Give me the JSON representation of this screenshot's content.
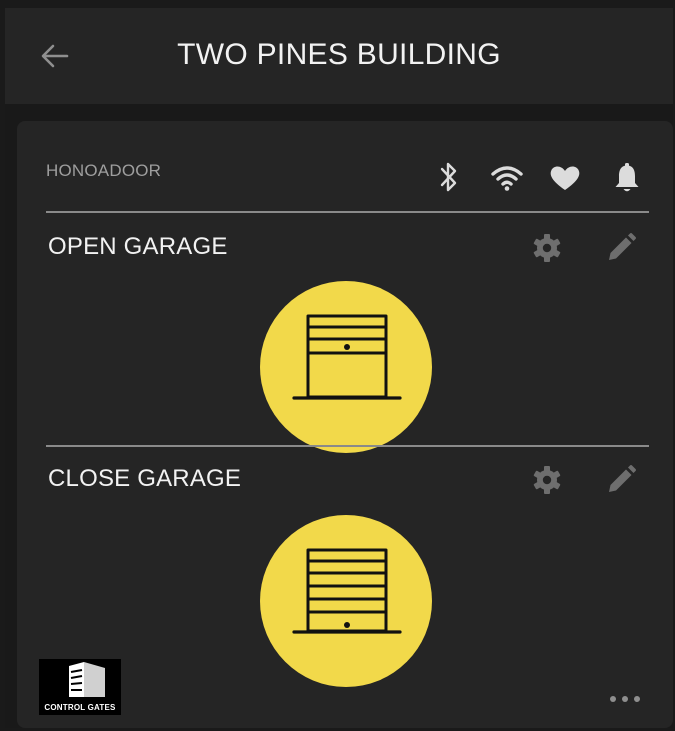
{
  "header": {
    "title": "TWO PINES BUILDING",
    "back_icon": "arrow-left-icon"
  },
  "device": {
    "name": "HONOADOOR",
    "status_icons": [
      "bluetooth-icon",
      "wifi-icon",
      "heart-icon",
      "bell-icon"
    ]
  },
  "actions": [
    {
      "label": "OPEN GARAGE",
      "icons": [
        "gear-icon",
        "pencil-icon"
      ],
      "button_icon": "garage-door-open-icon"
    },
    {
      "label": "CLOSE GARAGE",
      "icons": [
        "gear-icon",
        "pencil-icon"
      ],
      "button_icon": "garage-door-closed-icon"
    }
  ],
  "footer": {
    "logo_text": "CONTROL GATES",
    "more_icon": "more-horizontal-icon"
  },
  "colors": {
    "background": "#191919",
    "header": "#252525",
    "panel": "#252525",
    "accent": "#f2d94a",
    "icon": "#dcdcdc",
    "muted_icon": "#6e6e6e",
    "label": "#f2f2f2",
    "device_name": "#9e9e9e"
  }
}
